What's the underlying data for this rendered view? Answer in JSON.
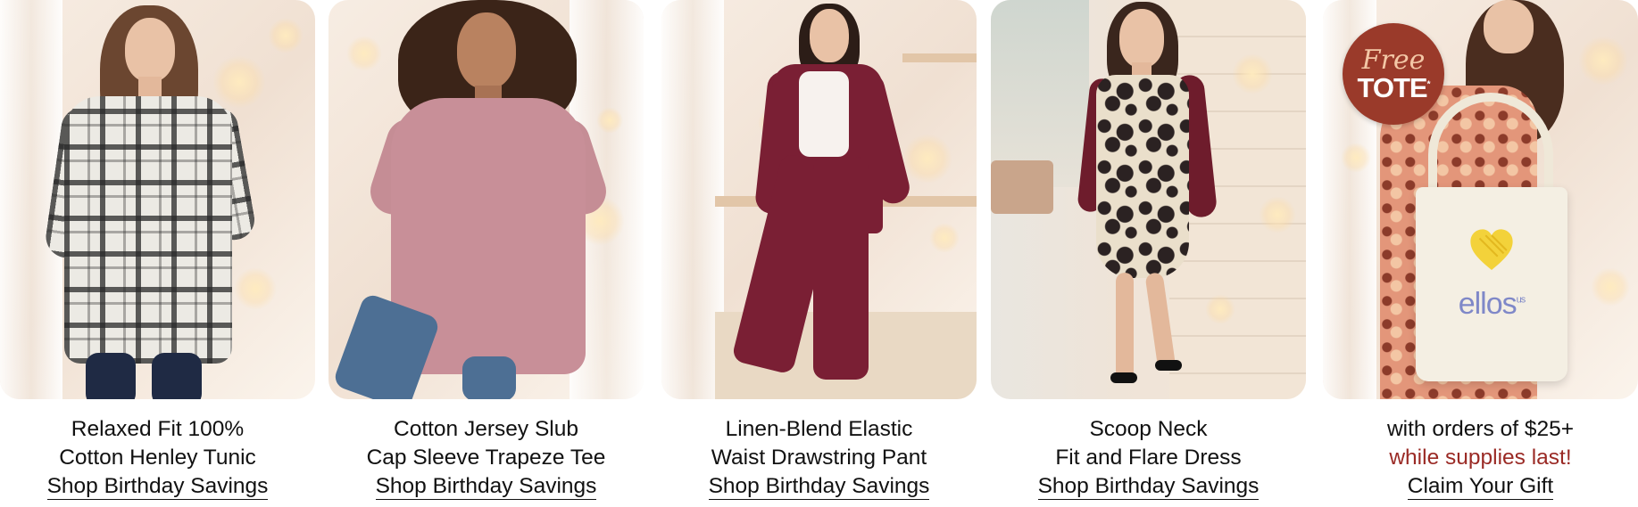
{
  "cards": [
    {
      "line1": "Relaxed Fit 100%",
      "line2": "Cotton Henley Tunic",
      "link": "Shop Birthday Savings"
    },
    {
      "line1": "Cotton Jersey Slub",
      "line2": "Cap Sleeve Trapeze Tee",
      "link": "Shop Birthday Savings"
    },
    {
      "line1": "Linen-Blend Elastic",
      "line2": "Waist Drawstring Pant",
      "link": "Shop Birthday Savings"
    },
    {
      "line1": "Scoop Neck",
      "line2": "Fit and Flare Dress",
      "link": "Shop Birthday Savings"
    },
    {
      "line1": "with orders of $25+",
      "line2": "while supplies last!",
      "link": "Claim Your Gift",
      "badge": {
        "free": "Free",
        "tote": "TOTE",
        "trademark": "*"
      },
      "tote_logo": "ellos",
      "tote_logo_suffix": "us"
    }
  ],
  "colors": {
    "accent": "#9a2a25",
    "badge": "#9a3a2a",
    "burgundy": "#7a1f34",
    "tote_logo": "#7f88c8",
    "heart": "#f3d23a"
  },
  "icons": [
    "heart-icon"
  ]
}
